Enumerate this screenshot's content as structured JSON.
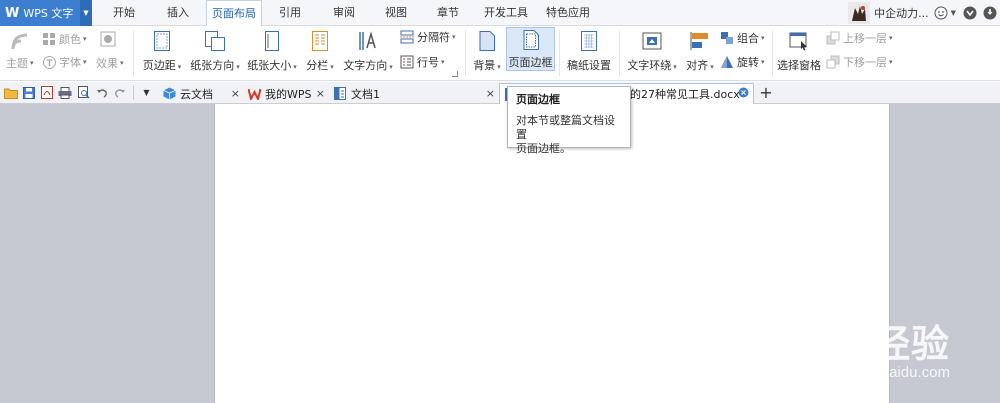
{
  "app": {
    "logo_letter": "W",
    "name": "WPS 文字",
    "menu_arrow": "▼"
  },
  "menu_tabs": [
    {
      "label": "开始",
      "active": false
    },
    {
      "label": "插入",
      "active": false
    },
    {
      "label": "页面布局",
      "active": true
    },
    {
      "label": "引用",
      "active": false
    },
    {
      "label": "审阅",
      "active": false
    },
    {
      "label": "视图",
      "active": false
    },
    {
      "label": "章节",
      "active": false
    },
    {
      "label": "开发工具",
      "active": false
    },
    {
      "label": "特色应用",
      "active": false
    }
  ],
  "user": {
    "name": "中企动力...",
    "dropdown": "▼"
  },
  "ribbon": {
    "theme": "主题",
    "color": "颜色",
    "font": "字体",
    "effect": "效果",
    "margins": "页边距",
    "orientation": "纸张方向",
    "size": "纸张大小",
    "columns": "分栏",
    "text_direction": "文字方向",
    "breaks": "分隔符",
    "line_numbers": "行号",
    "background": "背景",
    "page_border": "页面边框",
    "manuscript": "稿纸设置",
    "text_wrap": "文字环绕",
    "align": "对齐",
    "group": "组合",
    "rotate": "旋转",
    "selection_pane": "选择窗格",
    "bring_forward": "上移一层",
    "send_backward": "下移一层",
    "dropdown": "▾"
  },
  "doc_tabs": [
    {
      "label": "云文档",
      "icon": "cloud-doc-icon"
    },
    {
      "label": "我的WPS",
      "icon": "wps-logo-icon"
    },
    {
      "label": "文档1",
      "icon": "document-icon"
    },
    {
      "label": "的27种常见工具.docx",
      "icon": "document-icon"
    }
  ],
  "tab_close": "×",
  "new_tab": "+",
  "tooltip": {
    "title": "页面边框",
    "line1": "对本节或整篇文档设置",
    "line2": "页面边框。"
  },
  "watermark": {
    "main": "Baidu 经验",
    "url": "jingyan.baidu.com"
  },
  "colors": {
    "accent": "#3c7fd0",
    "active_tab_text": "#1f63b5",
    "workarea_bg": "#c6c9d1"
  }
}
